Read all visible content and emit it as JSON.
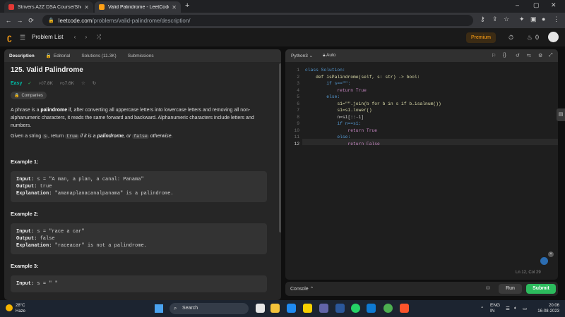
{
  "browser": {
    "tabs": [
      {
        "label": "Strivers A2Z DSA Course/Sheet",
        "close": "✕"
      },
      {
        "label": "Valid Palindrome - LeetCode",
        "close": "✕"
      }
    ],
    "new_tab": "+",
    "window_controls": [
      "–",
      "▢",
      "✕"
    ],
    "url_host": "leetcode.com",
    "url_path": "/problems/valid-palindrome/description/"
  },
  "header": {
    "problem_list": "Problem List",
    "premium": "Premium",
    "streak": "0"
  },
  "left": {
    "tabs": [
      "Description",
      "Editorial",
      "Solutions (11.3K)",
      "Submissions"
    ],
    "title": "125. Valid Palindrome",
    "difficulty": "Easy",
    "likes": "7.8K",
    "dislikes": "7.6K",
    "companies": "Companies",
    "desc_p1_a": "A phrase is a ",
    "desc_p1_b": "palindrome",
    "desc_p1_c": " if, after converting all uppercase letters into lowercase letters and removing all non-alphanumeric characters, it reads the same forward and backward. Alphanumeric characters include letters and numbers.",
    "desc_p2_a": "Given a string ",
    "desc_p2_s": "s",
    "desc_p2_b": ", return ",
    "desc_p2_true": "true",
    "desc_p2_c": " if it is a ",
    "desc_p2_pal": "palindrome",
    "desc_p2_d": ", or ",
    "desc_p2_false": "false",
    "desc_p2_e": " otherwise.",
    "examples": [
      {
        "head": "Example 1:",
        "input": "s = \"A man, a plan, a canal: Panama\"",
        "output": "true",
        "explanation": "\"amanaplanacanalpanama\" is a palindrome."
      },
      {
        "head": "Example 2:",
        "input": "s = \"race a car\"",
        "output": "false",
        "explanation": "\"raceacar\" is not a palindrome."
      },
      {
        "head": "Example 3:",
        "input": "s = \" \"",
        "output": "",
        "explanation": ""
      }
    ],
    "labels": {
      "input": "Input:",
      "output": "Output:",
      "explanation": "Explanation:"
    }
  },
  "right": {
    "language": "Python3",
    "mode": "Auto",
    "code_lines": [
      "class Solution:",
      "    def isPalindrome(self, s: str) -> bool:",
      "        if s==\"\":",
      "            return True",
      "        else:",
      "            s1=\"\".join(b for b in s if b.isalnum())",
      "            s1=s1.lower()",
      "            n=s1[::-1]",
      "            if n==s1:",
      "                return True",
      "            else:",
      "                return False"
    ],
    "cursor_status": "Ln 12, Col 29",
    "console": "Console",
    "run": "Run",
    "submit": "Submit"
  },
  "taskbar": {
    "temp": "28°C",
    "weather": "Haze",
    "search": "Search",
    "lang": "ENG",
    "region": "IN",
    "time": "20:06",
    "date": "16-08-2023"
  }
}
